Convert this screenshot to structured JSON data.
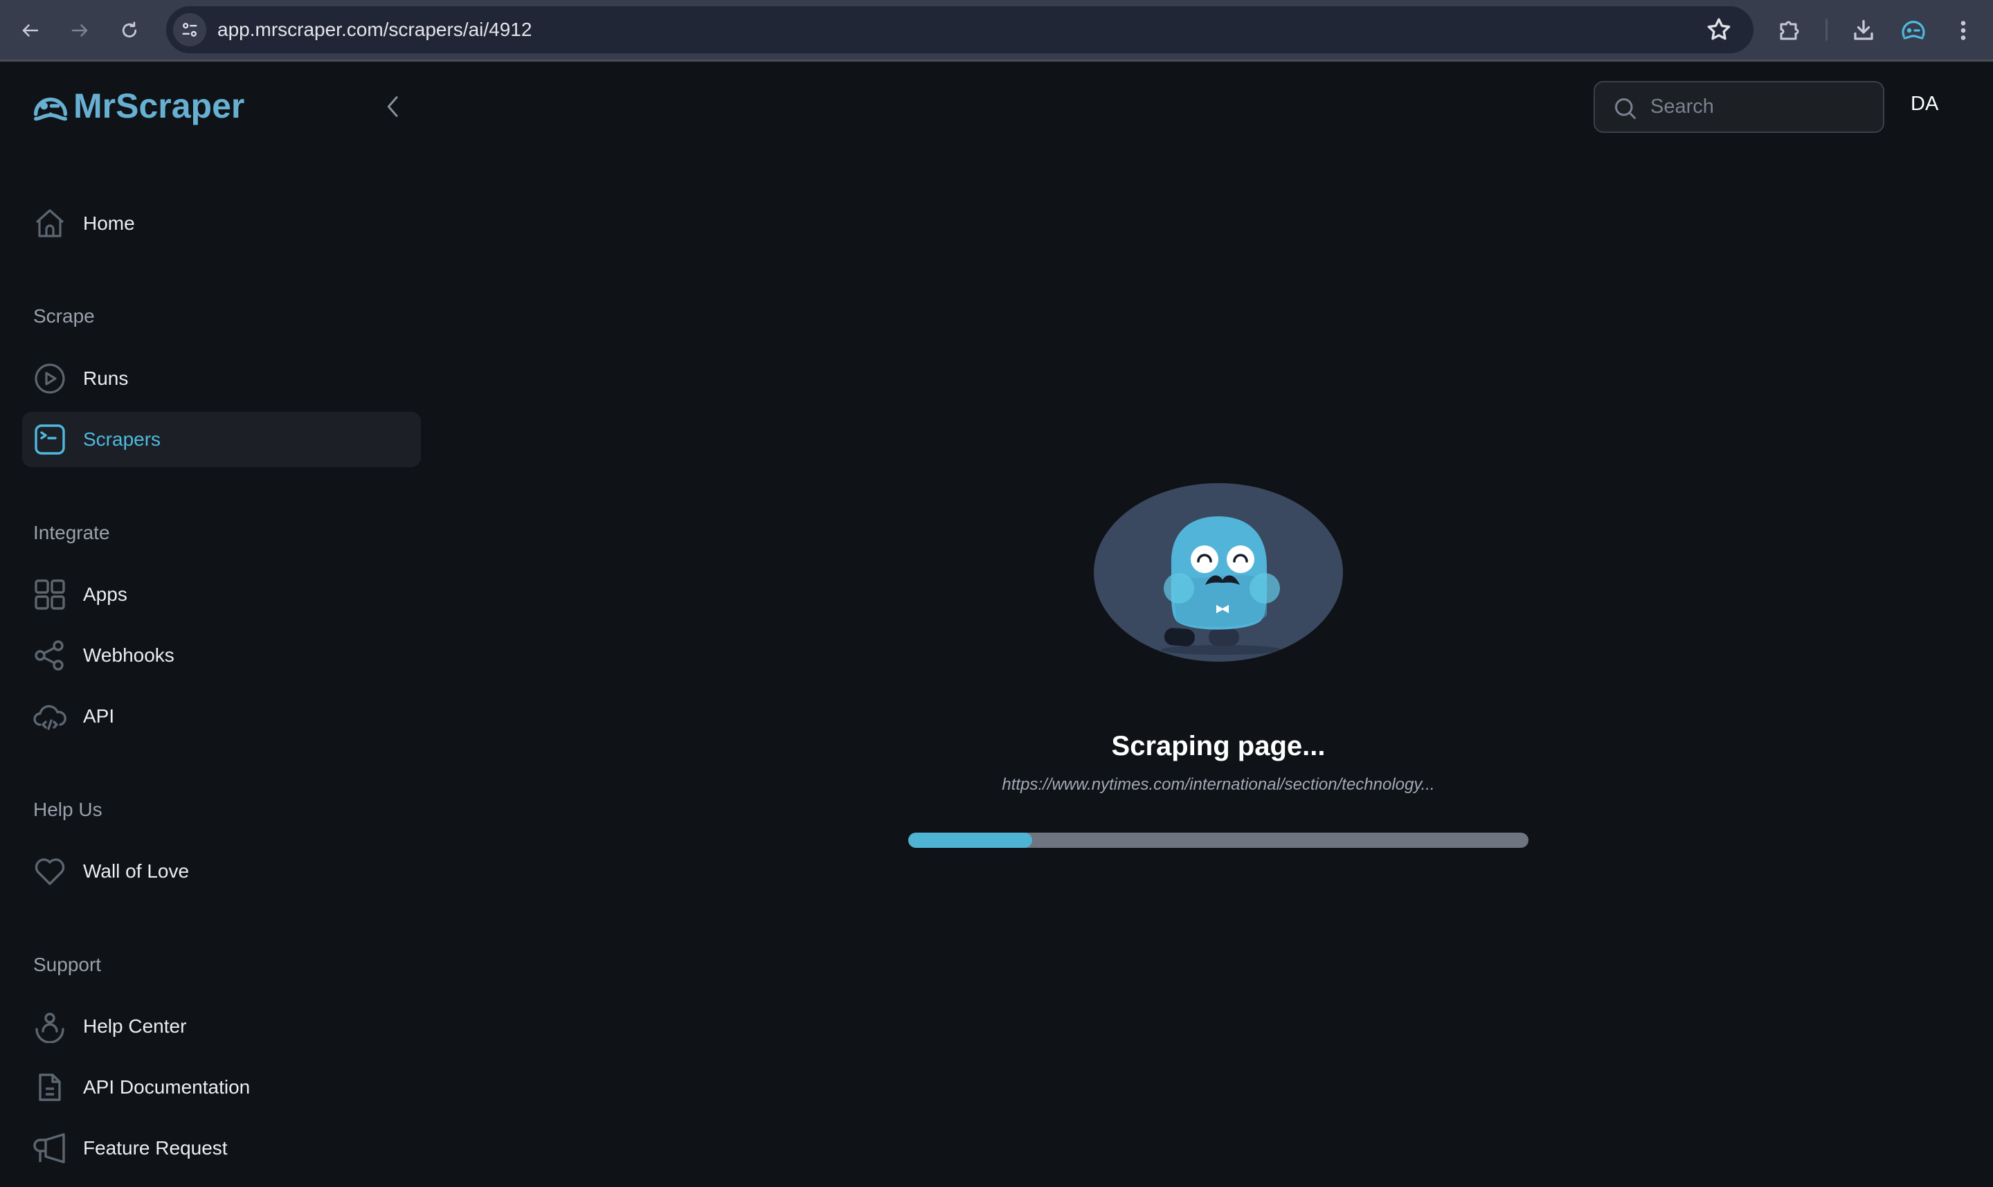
{
  "browser": {
    "url": "app.mrscraper.com/scrapers/ai/4912",
    "icons": [
      "back-icon",
      "forward-icon",
      "reload-icon",
      "site-info-icon",
      "bookmark-star-icon",
      "extensions-icon",
      "download-icon",
      "profile-mrscraper-icon",
      "more-menu-icon"
    ]
  },
  "app": {
    "logo_text": "MrScraper",
    "brand_color": "#67b0d2",
    "accent_color": "#4ebae0"
  },
  "header": {
    "search_placeholder": "Search",
    "search_value": "",
    "avatar_initials": "DA"
  },
  "sidebar": {
    "home": {
      "label": "Home",
      "icon": "home-icon"
    },
    "sections": [
      {
        "title": "Scrape",
        "items": [
          {
            "label": "Runs",
            "icon": "play-circle-icon",
            "active": false
          },
          {
            "label": "Scrapers",
            "icon": "terminal-icon",
            "active": true
          }
        ]
      },
      {
        "title": "Integrate",
        "items": [
          {
            "label": "Apps",
            "icon": "grid-icon",
            "active": false
          },
          {
            "label": "Webhooks",
            "icon": "share-icon",
            "active": false
          },
          {
            "label": "API",
            "icon": "cloud-code-icon",
            "active": false
          }
        ]
      },
      {
        "title": "Help Us",
        "items": [
          {
            "label": "Wall of Love",
            "icon": "heart-icon",
            "active": false
          }
        ]
      },
      {
        "title": "Support",
        "items": [
          {
            "label": "Help Center",
            "icon": "person-support-icon",
            "active": false
          },
          {
            "label": "API Documentation",
            "icon": "document-icon",
            "active": false
          },
          {
            "label": "Feature Request",
            "icon": "megaphone-icon",
            "active": false
          }
        ]
      }
    ]
  },
  "main": {
    "status_title": "Scraping page...",
    "status_url": "https://www.nytimes.com/international/section/technology...",
    "progress_percent": 20
  }
}
